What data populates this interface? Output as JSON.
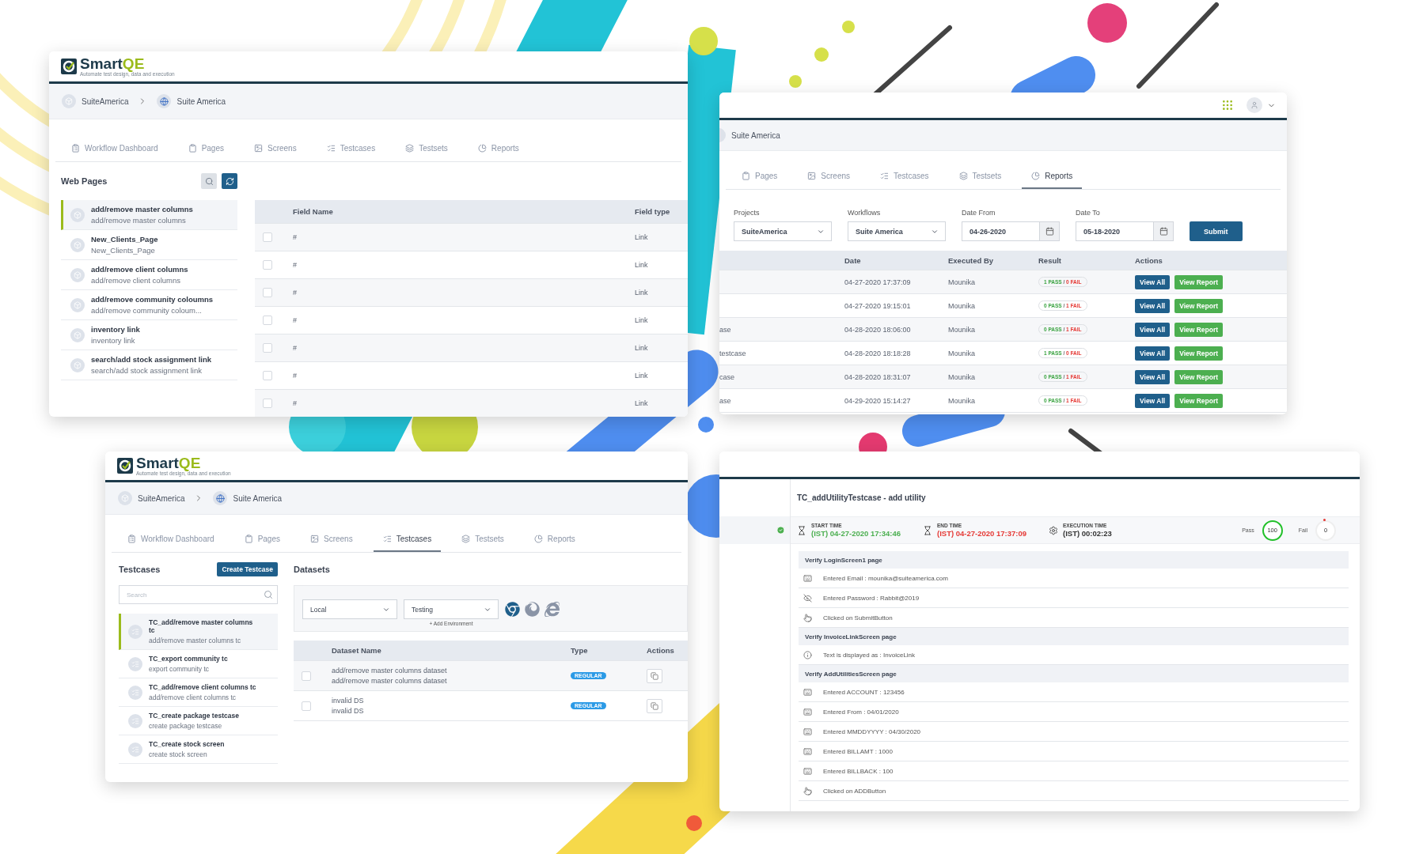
{
  "pages_window": {
    "logo": {
      "word": "Smart",
      "accent": "QE",
      "tagline": "Automate test design, data and execution"
    },
    "breadcrumb": [
      {
        "kind": "project",
        "label": "SuiteAmerica"
      },
      {
        "kind": "workflow",
        "label": "Suite America"
      }
    ],
    "tabs": [
      {
        "kind": "dashboard",
        "label": "Workflow Dashboard",
        "selected": false
      },
      {
        "kind": "pages",
        "label": "Pages",
        "selected": false
      },
      {
        "kind": "screens",
        "label": "Screens",
        "selected": false
      },
      {
        "kind": "testcases",
        "label": "Testcases",
        "selected": false
      },
      {
        "kind": "testsets",
        "label": "Testsets",
        "selected": false
      },
      {
        "kind": "reports",
        "label": "Reports",
        "selected": false
      }
    ],
    "sidebar": {
      "title": "Web Pages",
      "items": [
        {
          "title": "add/remove master columns",
          "subtitle": "add/remove master columns",
          "selected": true
        },
        {
          "title": "New_Clients_Page",
          "subtitle": "New_Clients_Page",
          "selected": false
        },
        {
          "title": "add/remove client columns",
          "subtitle": "add/remove client columns",
          "selected": false
        },
        {
          "title": "add/remove community coloumns",
          "subtitle": "add/remove community coloum...",
          "selected": false
        },
        {
          "title": "inventory link",
          "subtitle": "inventory link",
          "selected": false
        },
        {
          "title": "search/add stock assignment link",
          "subtitle": "search/add stock assignment link",
          "selected": false
        }
      ]
    },
    "table": {
      "columns": [
        "Field Name",
        "Field type"
      ],
      "rows": [
        {
          "field_name": "#",
          "field_type": "Link",
          "checked": false
        },
        {
          "field_name": "#",
          "field_type": "Link",
          "checked": false
        },
        {
          "field_name": "#",
          "field_type": "Link",
          "checked": false
        },
        {
          "field_name": "#",
          "field_type": "Link",
          "checked": false
        },
        {
          "field_name": "#",
          "field_type": "Link",
          "checked": false
        },
        {
          "field_name": "#",
          "field_type": "Link",
          "checked": false
        },
        {
          "field_name": "#",
          "field_type": "Link",
          "checked": false
        }
      ]
    }
  },
  "reports_window": {
    "breadcrumb": [
      {
        "kind": "plain",
        "label": "Suite America"
      }
    ],
    "tabs": [
      {
        "kind": "pages",
        "label": "Pages",
        "selected": false
      },
      {
        "kind": "screens",
        "label": "Screens",
        "selected": false
      },
      {
        "kind": "testcases",
        "label": "Testcases",
        "selected": false
      },
      {
        "kind": "testsets",
        "label": "Testsets",
        "selected": false
      },
      {
        "kind": "reports",
        "label": "Reports",
        "selected": true
      }
    ],
    "filters": [
      {
        "kind": "select",
        "label": "Projects",
        "value": "SuiteAmerica"
      },
      {
        "kind": "select",
        "label": "Workflows",
        "value": "Suite America"
      },
      {
        "kind": "date",
        "label": "Date From",
        "value": "04-26-2020"
      },
      {
        "kind": "date",
        "label": "Date To",
        "value": "05-18-2020"
      }
    ],
    "submit": "Submit",
    "table": {
      "columns": [
        "Date",
        "Executed By",
        "Result",
        "Actions"
      ],
      "rows": [
        {
          "date": "04-27-2020 17:37:09",
          "executed_by": "Mounika",
          "pass": "1 PASS",
          "divider": "/",
          "fail": "0 FAIL",
          "actions": [
            {
              "kind": "view_all",
              "label": "View All"
            },
            {
              "kind": "view_report",
              "label": "View Report"
            }
          ]
        },
        {
          "date": "04-27-2020 19:15:01",
          "executed_by": "Mounika",
          "pass": "0 PASS",
          "divider": "/",
          "fail": "1 FAIL",
          "actions": [
            {
              "kind": "view_all",
              "label": "View All"
            },
            {
              "kind": "view_report",
              "label": "View Report"
            }
          ]
        },
        {
          "column_1": "ase",
          "date": "04-28-2020 18:06:00",
          "executed_by": "Mounika",
          "pass": "0 PASS",
          "divider": "/",
          "fail": "1 FAIL",
          "actions": [
            {
              "kind": "view_all",
              "label": "View All"
            },
            {
              "kind": "view_report",
              "label": "View Report"
            }
          ]
        },
        {
          "column_1": "testcase",
          "date": "04-28-2020 18:18:28",
          "executed_by": "Mounika",
          "pass": "1 PASS",
          "divider": "/",
          "fail": "0 FAIL",
          "actions": [
            {
              "kind": "view_all",
              "label": "View All"
            },
            {
              "kind": "view_report",
              "label": "View Report"
            }
          ]
        },
        {
          "column_1": "case",
          "date": "04-28-2020 18:31:07",
          "executed_by": "Mounika",
          "pass": "0 PASS",
          "divider": "/",
          "fail": "1 FAIL",
          "actions": [
            {
              "kind": "view_all",
              "label": "View All"
            },
            {
              "kind": "view_report",
              "label": "View Report"
            }
          ]
        },
        {
          "column_1": "ase",
          "date": "04-29-2020 15:14:27",
          "executed_by": "Mounika",
          "pass": "0 PASS",
          "divider": "/",
          "fail": "1 FAIL",
          "actions": [
            {
              "kind": "view_all",
              "label": "View All"
            },
            {
              "kind": "view_report",
              "label": "View Report"
            }
          ]
        }
      ]
    }
  },
  "testcases_window": {
    "logo": {
      "word": "Smart",
      "accent": "QE",
      "tagline": "Automate test design, data and execution"
    },
    "breadcrumb": [
      {
        "kind": "project",
        "label": "SuiteAmerica"
      },
      {
        "kind": "workflow",
        "label": "Suite America"
      }
    ],
    "tabs": [
      {
        "kind": "dashboard",
        "label": "Workflow Dashboard",
        "selected": false
      },
      {
        "kind": "pages",
        "label": "Pages",
        "selected": false
      },
      {
        "kind": "screens",
        "label": "Screens",
        "selected": false
      },
      {
        "kind": "testcases",
        "label": "Testcases",
        "selected": true
      },
      {
        "kind": "testsets",
        "label": "Testsets",
        "selected": false
      },
      {
        "kind": "reports",
        "label": "Reports",
        "selected": false
      }
    ],
    "testcases": {
      "title": "Testcases",
      "create_button": "Create Testcase",
      "search_placeholder": "Search",
      "items": [
        {
          "title": "TC_add/remove master columns tc",
          "subtitle": "add/remove master columns tc",
          "selected": true
        },
        {
          "title": "TC_export community tc",
          "subtitle": "export community tc",
          "selected": false
        },
        {
          "title": "TC_add/remove client columns tc",
          "subtitle": "add/remove client columns tc",
          "selected": false
        },
        {
          "title": "TC_create package testcase",
          "subtitle": "create package testcase",
          "selected": false
        },
        {
          "title": "TC_create stock screen",
          "subtitle": "create stock screen",
          "selected": false
        }
      ]
    },
    "datasets": {
      "title": "Datasets",
      "environments": [
        "Local",
        "Testing"
      ],
      "add_environment": "+ Add Environment",
      "table": {
        "columns": [
          "Dataset Name",
          "Type",
          "Actions"
        ],
        "rows": [
          {
            "name": "add/remove master columns dataset",
            "description": "add/remove master columns dataset",
            "type": "REGULAR",
            "checked": false
          },
          {
            "name": "invalid DS",
            "description": "invalid DS",
            "type": "REGULAR",
            "checked": false
          }
        ]
      }
    }
  },
  "report_window": {
    "title": "TC_addUtilityTestcase - add utility",
    "times": [
      {
        "kind": "start",
        "label": "START TIME",
        "value": "(IST) 04-27-2020 17:34:46",
        "color": "#4caf50"
      },
      {
        "kind": "end",
        "label": "END TIME",
        "value": "(IST) 04-27-2020 17:37:09",
        "color": "#e53935"
      },
      {
        "kind": "duration",
        "label": "EXECUTION TIME",
        "value": "(IST) 00:02:23",
        "color": "#333333"
      }
    ],
    "pass": {
      "label": "Pass",
      "count": "100"
    },
    "fail": {
      "label": "Fail",
      "count": "0"
    },
    "sections": [
      {
        "title": "Verify LoginScreen1 page",
        "steps": [
          {
            "kind": "input",
            "text": "Entered Email : mounika@suiteamerica.com"
          },
          {
            "kind": "password",
            "text": "Entered Password : Rabbit@2019"
          },
          {
            "kind": "click",
            "text": "Clicked on SubmitButton"
          }
        ]
      },
      {
        "title": "Verify InvoiceLinkScreen page",
        "steps": [
          {
            "kind": "info",
            "text": "Text is displayed as : InvoiceLink"
          }
        ]
      },
      {
        "title": "Verify AddUtilitiesScreen page",
        "steps": [
          {
            "kind": "input",
            "text": "Entered ACCOUNT : 123456"
          },
          {
            "kind": "input",
            "text": "Entered From : 04/01/2020"
          },
          {
            "kind": "input",
            "text": "Entered MMDDYYYY : 04/30/2020"
          },
          {
            "kind": "input",
            "text": "Entered BILLAMT : 1000"
          },
          {
            "kind": "input",
            "text": "Entered BILLBACK : 100"
          },
          {
            "kind": "click",
            "text": "Clicked on ADDButton"
          }
        ]
      }
    ]
  }
}
